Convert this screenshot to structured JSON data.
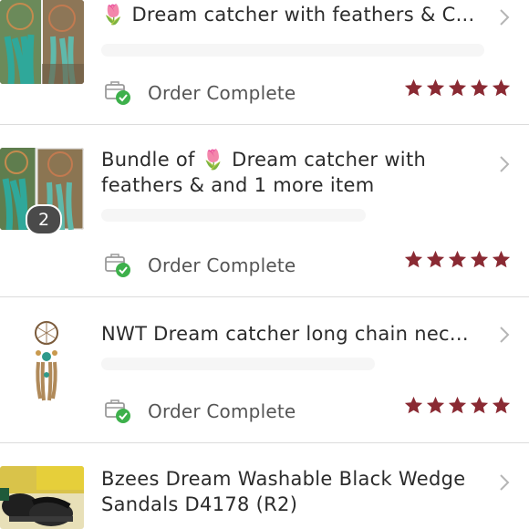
{
  "orders": [
    {
      "title_emoji": "🌷",
      "title": "Dream catcher with feathers & C...",
      "status": "Order Complete",
      "rating": 5,
      "thumbnail": "dream-catcher-photo"
    },
    {
      "title_prefix": "Bundle of ",
      "title_emoji": "🌷",
      "title_line1_rest": "Dream catcher with",
      "title_line2": "feathers &  and 1 more item",
      "item_count": "2",
      "status": "Order Complete",
      "rating": 5,
      "thumbnail": "dream-catcher-photo"
    },
    {
      "title": "NWT Dream catcher long chain nec...",
      "status": "Order Complete",
      "rating": 5,
      "thumbnail": "dream-catcher-necklace-photo"
    },
    {
      "title_line1": "Bzees Dream Washable Black Wedge",
      "title_line2": "Sandals D4178  (R2)",
      "thumbnail": "black-sandals-photo"
    }
  ],
  "colors": {
    "star": "#8a2a33",
    "check": "#3db04b",
    "divider": "#dcdcdc",
    "chevron": "#b5b5b5"
  }
}
